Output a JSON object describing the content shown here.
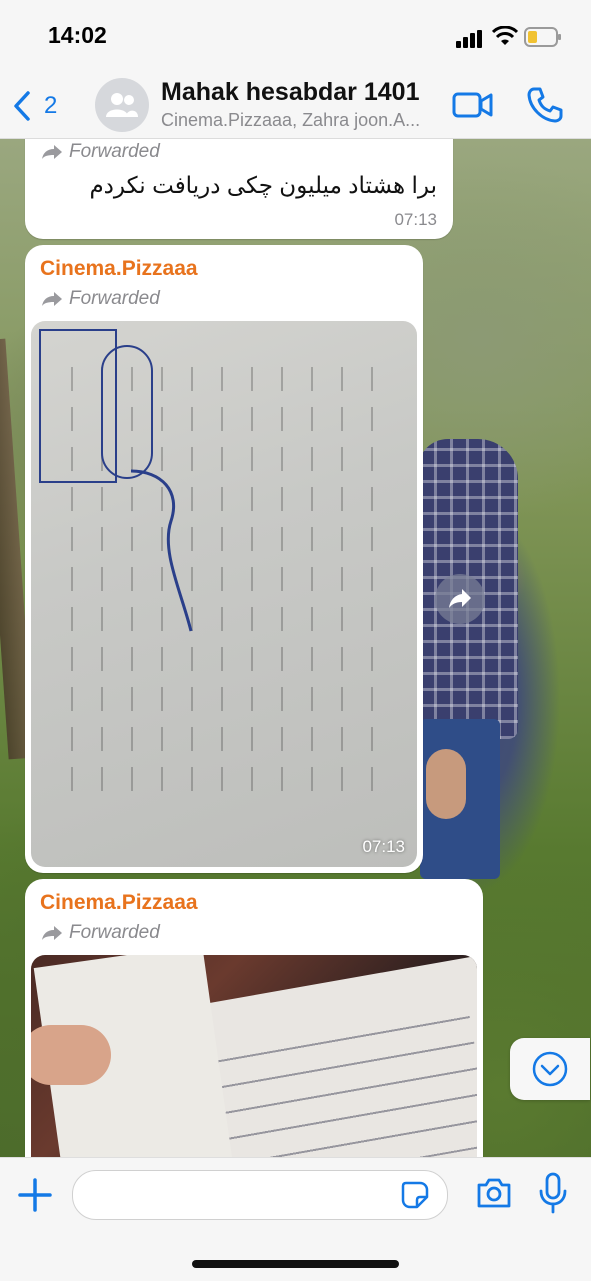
{
  "status_bar": {
    "time": "14:02"
  },
  "header": {
    "back_count": "2",
    "title": "Mahak hesabdar 1401",
    "subtitle": "Cinema.Pizzaaa, Zahra joon.A..."
  },
  "messages": [
    {
      "forwarded_label": "Forwarded",
      "text": "برا هشتاد میلیون چکی دریافت نکردم",
      "time": "07:13"
    },
    {
      "sender": "Cinema.Pizzaaa",
      "forwarded_label": "Forwarded",
      "media": "photo-receipt",
      "time": "07:13"
    },
    {
      "sender": "Cinema.Pizzaaa",
      "forwarded_label": "Forwarded",
      "media": "photo-cheque"
    }
  ],
  "composer": {
    "placeholder": ""
  },
  "colors": {
    "accent": "#1479e6",
    "sender": "#e8731d"
  }
}
